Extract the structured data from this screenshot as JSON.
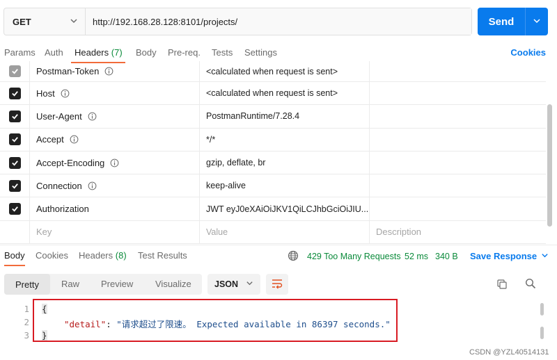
{
  "request": {
    "method": "GET",
    "url": "http://192.168.28.128:8101/projects/",
    "send_label": "Send"
  },
  "request_tabs": {
    "params": "Params",
    "auth": "Auth",
    "headers": "Headers",
    "headers_count": "(7)",
    "body": "Body",
    "prereq": "Pre-req.",
    "tests": "Tests",
    "settings": "Settings",
    "cookies": "Cookies"
  },
  "headers_table": {
    "rows": [
      {
        "key": "Postman-Token",
        "value": "<calculated when request is sent>",
        "checked": true,
        "disabled": true,
        "info": true
      },
      {
        "key": "Host",
        "value": "<calculated when request is sent>",
        "checked": true,
        "disabled": false,
        "info": true
      },
      {
        "key": "User-Agent",
        "value": "PostmanRuntime/7.28.4",
        "checked": true,
        "disabled": false,
        "info": true
      },
      {
        "key": "Accept",
        "value": "*/*",
        "checked": true,
        "disabled": false,
        "info": true
      },
      {
        "key": "Accept-Encoding",
        "value": "gzip, deflate, br",
        "checked": true,
        "disabled": false,
        "info": true
      },
      {
        "key": "Connection",
        "value": "keep-alive",
        "checked": true,
        "disabled": false,
        "info": true
      },
      {
        "key": "Authorization",
        "value": "JWT eyJ0eXAiOiJKV1QiLCJhbGciOiJIU...",
        "checked": true,
        "disabled": false,
        "info": false
      }
    ],
    "placeholder": {
      "key": "Key",
      "value": "Value",
      "description": "Description"
    }
  },
  "response_tabs": {
    "body": "Body",
    "cookies": "Cookies",
    "headers": "Headers",
    "headers_count": "(8)",
    "test_results": "Test Results",
    "status": "429 Too Many Requests",
    "time": "52 ms",
    "size": "340 B",
    "save_response": "Save Response"
  },
  "format": {
    "pretty": "Pretty",
    "raw": "Raw",
    "preview": "Preview",
    "visualize": "Visualize",
    "language": "JSON"
  },
  "code": {
    "line_numbers": [
      "1",
      "2",
      "3"
    ],
    "open_brace": "{",
    "key": "\"detail\"",
    "colon": ": ",
    "value": "\"请求超过了限速。 Expected available in 86397 seconds.\"",
    "close_brace": "}"
  },
  "watermark": "CSDN @YZL40514131",
  "colors": {
    "accent": "#097bed",
    "tab_underline": "#f26b3a",
    "status_green": "#0a8a3a",
    "highlight_red": "#d81b23"
  }
}
